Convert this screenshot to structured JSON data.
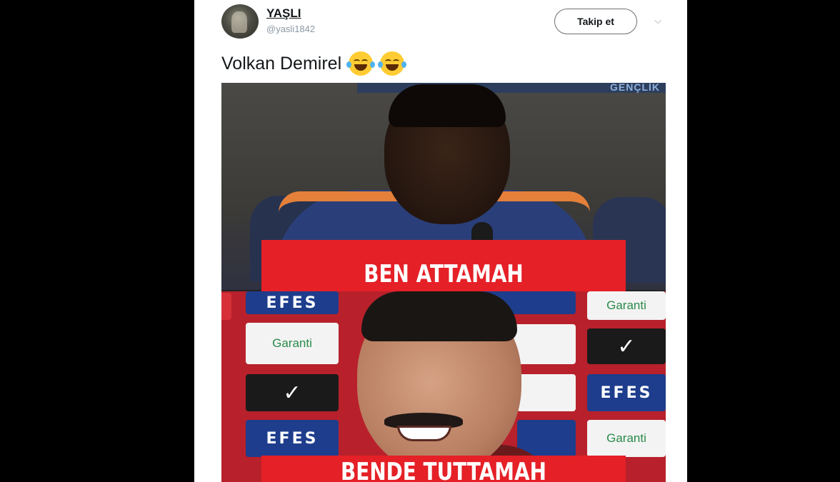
{
  "tweet": {
    "author_name": "YAŞLI",
    "author_handle": "@yasli1842",
    "follow_label": "Takip et",
    "caret_icon": "chevron-down-icon",
    "text": "Volkan Demirel",
    "emojis": [
      "face-with-tears-of-joy-icon",
      "face-with-tears-of-joy-icon"
    ]
  },
  "meme": {
    "caption_top": "BEN ATTAMAH",
    "caption_bottom": "BENDE TUTTAMAH",
    "banner_text": "GENÇLİK",
    "sponsor_efes": "EFES",
    "sponsor_garanti": "Garanti",
    "caption_color": "#e52027"
  }
}
